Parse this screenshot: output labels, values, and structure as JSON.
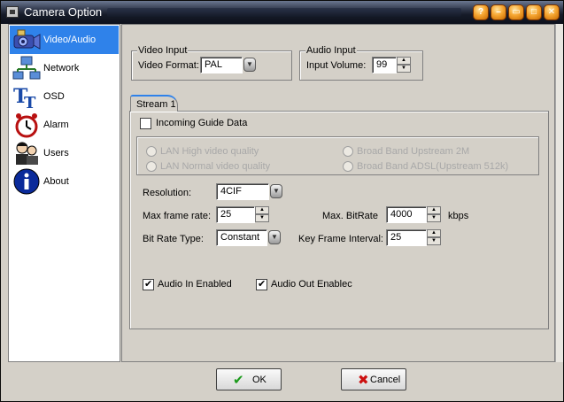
{
  "window": {
    "title": "Camera Option"
  },
  "title_buttons": [
    {
      "name": "help-button",
      "glyph": "?"
    },
    {
      "name": "minimize-button",
      "glyph": "–"
    },
    {
      "name": "restore-button",
      "glyph": "▭"
    },
    {
      "name": "maximize-button",
      "glyph": "□"
    },
    {
      "name": "close-button",
      "glyph": "✕"
    }
  ],
  "sidebar": {
    "items": [
      {
        "label": "Video/Audio",
        "icon": "camera-icon",
        "active": true
      },
      {
        "label": "Network",
        "icon": "network-icon",
        "active": false
      },
      {
        "label": "OSD",
        "icon": "osd-icon",
        "active": false
      },
      {
        "label": "Alarm",
        "icon": "alarm-clock-icon",
        "active": false
      },
      {
        "label": "Users",
        "icon": "users-icon",
        "active": false
      },
      {
        "label": "About",
        "icon": "info-icon",
        "active": false
      }
    ]
  },
  "video_input": {
    "title": "Video Input",
    "format_label": "Video Format:",
    "format_value": "PAL"
  },
  "audio_input": {
    "title": "Audio Input",
    "volume_label": "Input Volume:",
    "volume_value": "99"
  },
  "stream": {
    "tab_label": "Stream 1",
    "guide_label": "Incoming Guide Data",
    "guide_checked": false,
    "quality_options": [
      "LAN High video quality",
      "LAN Normal video quality",
      "Broad Band Upstream 2M",
      "Broad Band ADSL(Upstream 512k)"
    ],
    "resolution_label": "Resolution:",
    "resolution_value": "4CIF",
    "framerate_label": "Max frame rate:",
    "framerate_value": "25",
    "bitrate_label": "Max. BitRate",
    "bitrate_value": "4000",
    "bitrate_unit": "kbps",
    "bitrate_type_label": "Bit Rate Type:",
    "bitrate_type_value": "Constant",
    "keyframe_label": "Key Frame Interval:",
    "keyframe_value": "25",
    "audio_in_label": "Audio In Enabled",
    "audio_in_checked": true,
    "audio_out_label": "Audio Out Enablec",
    "audio_out_checked": true
  },
  "footer": {
    "ok_label": "OK",
    "cancel_label": "Cancel"
  },
  "colors": {
    "accent": "#2f82ea",
    "ok_check": "#1a9a1a",
    "cancel_x": "#cc1010"
  }
}
